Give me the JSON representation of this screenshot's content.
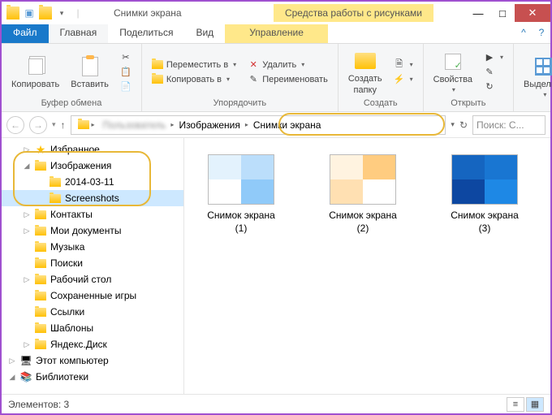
{
  "title": "Снимки экрана",
  "picture_tools": "Средства работы с рисунками",
  "window": {
    "min": "—",
    "max": "□",
    "close": "✕"
  },
  "tabs": {
    "file": "Файл",
    "home": "Главная",
    "share": "Поделиться",
    "view": "Вид",
    "manage": "Управление"
  },
  "ribbon": {
    "clipboard": {
      "copy": "Копировать",
      "paste": "Вставить",
      "label": "Буфер обмена"
    },
    "organize": {
      "move_to": "Переместить в",
      "copy_to": "Копировать в",
      "delete": "Удалить",
      "rename": "Переименовать",
      "label": "Упорядочить"
    },
    "new": {
      "new_folder": "Создать",
      "new_folder2": "папку",
      "label": "Создать"
    },
    "open": {
      "properties": "Свойства",
      "label": "Открыть"
    },
    "select": {
      "select": "Выделить",
      "label": ""
    }
  },
  "breadcrumb": {
    "seg1": "Изображения",
    "seg2": "Снимки экрана"
  },
  "search_placeholder": "Поиск: С...",
  "tree": [
    {
      "indent": 1,
      "arrow": "▷",
      "icon": "star",
      "label": "Избранное"
    },
    {
      "indent": 1,
      "arrow": "◢",
      "icon": "folder",
      "label": "Изображения",
      "hl": true
    },
    {
      "indent": 2,
      "arrow": "",
      "icon": "folder",
      "label": "2014-03-11",
      "hl": true
    },
    {
      "indent": 2,
      "arrow": "",
      "icon": "folder",
      "label": "Screenshots",
      "selected": true,
      "hl": true
    },
    {
      "indent": 1,
      "arrow": "▷",
      "icon": "folder",
      "label": "Контакты"
    },
    {
      "indent": 1,
      "arrow": "▷",
      "icon": "folder",
      "label": "Мои документы"
    },
    {
      "indent": 1,
      "arrow": "",
      "icon": "folder",
      "label": "Музыка"
    },
    {
      "indent": 1,
      "arrow": "",
      "icon": "folder",
      "label": "Поиски"
    },
    {
      "indent": 1,
      "arrow": "▷",
      "icon": "folder",
      "label": "Рабочий стол"
    },
    {
      "indent": 1,
      "arrow": "",
      "icon": "folder",
      "label": "Сохраненные игры"
    },
    {
      "indent": 1,
      "arrow": "",
      "icon": "folder",
      "label": "Ссылки"
    },
    {
      "indent": 1,
      "arrow": "",
      "icon": "folder",
      "label": "Шаблоны"
    },
    {
      "indent": 1,
      "arrow": "▷",
      "icon": "folder",
      "label": "Яндекс.Диск"
    },
    {
      "indent": 0,
      "arrow": "▷",
      "icon": "pc",
      "label": "Этот компьютер"
    },
    {
      "indent": 0,
      "arrow": "◢",
      "icon": "lib",
      "label": "Библиотеки"
    }
  ],
  "items": [
    {
      "name1": "Снимок экрана",
      "name2": "(1)"
    },
    {
      "name1": "Снимок экрана",
      "name2": "(2)"
    },
    {
      "name1": "Снимок экрана",
      "name2": "(3)"
    }
  ],
  "status": {
    "label": "Элементов:",
    "count": "3"
  }
}
